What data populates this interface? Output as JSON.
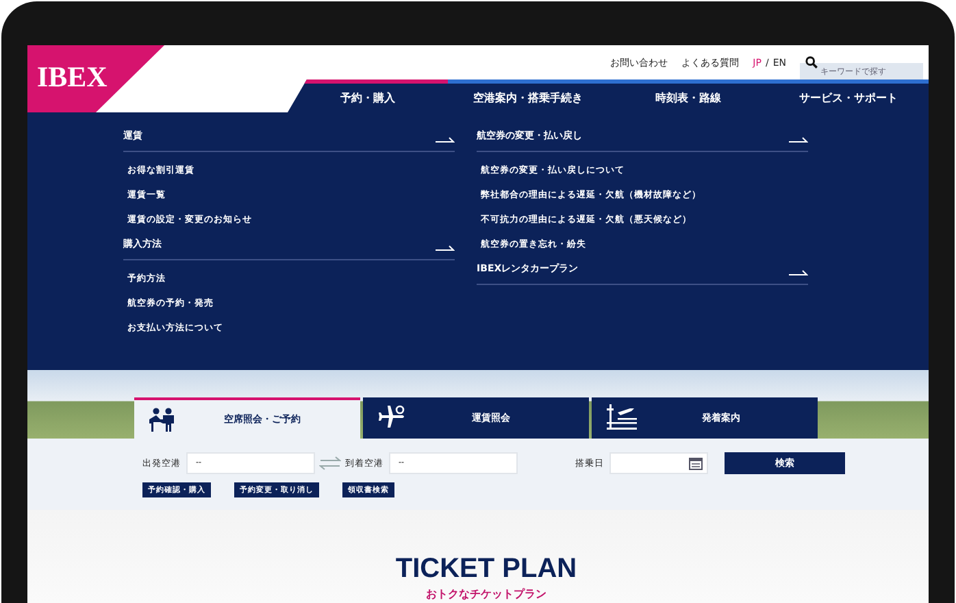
{
  "header": {
    "logo": "IBEX",
    "links": [
      "お問い合わせ",
      "よくある質問"
    ],
    "languages": [
      {
        "label": "JP",
        "selected": true
      },
      {
        "label": "EN",
        "selected": false
      }
    ],
    "language_separator": "/",
    "search": {
      "placeholder": "キーワードで探す"
    }
  },
  "nav": [
    {
      "label": "予約・購入",
      "selected": true
    },
    {
      "label": "空港案内・搭乗手続き",
      "selected": false
    },
    {
      "label": "時刻表・路線",
      "selected": false
    },
    {
      "label": "サービス・サポート",
      "selected": false
    }
  ],
  "mega_menu": {
    "columns": [
      {
        "sections": [
          {
            "title": "運賃",
            "items": [
              "お得な割引運賃",
              "運賃一覧",
              "運賃の設定・変更のお知らせ"
            ]
          },
          {
            "title": "購入方法",
            "items": [
              "予約方法",
              "航空券の予約・発売",
              "お支払い方法について"
            ]
          }
        ]
      },
      {
        "sections": [
          {
            "title": "航空券の変更・払い戻し",
            "items": [
              "航空券の変更・払い戻しについて",
              "弊社都合の理由による遅延・欠航（機材故障など）",
              "不可抗力の理由による遅延・欠航（悪天候など）",
              "航空券の置き忘れ・紛失"
            ]
          },
          {
            "title": "IBEXレンタカープラン"
          }
        ]
      }
    ]
  },
  "search_tabs": [
    {
      "label": "空席照会・ご予約",
      "kind": "people",
      "selected": true
    },
    {
      "label": "運賃照会",
      "kind": "plane",
      "selected": false
    },
    {
      "label": "発着案内",
      "kind": "board",
      "selected": false
    }
  ],
  "search_form": {
    "departure_label": "出発空港",
    "departure_value": "--",
    "arrival_label": "到着空港",
    "arrival_value": "--",
    "date_label": "搭乗日",
    "search_button": "検索",
    "links": [
      "予約確認・購入",
      "予約変更・取り消し",
      "領収書検索"
    ]
  },
  "ticket_plan": {
    "title": "TICKET PLAN",
    "subtitle": "おトクなチケットプラン"
  }
}
